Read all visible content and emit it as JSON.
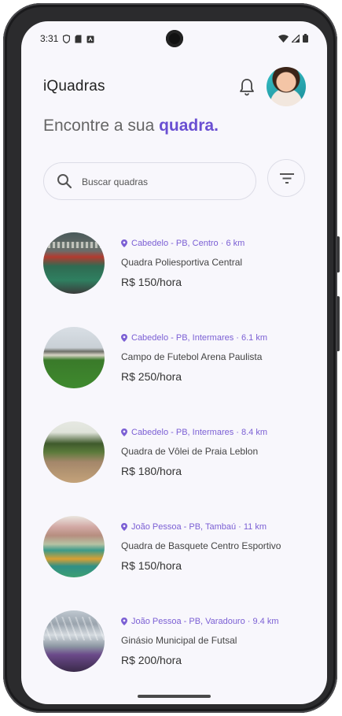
{
  "status": {
    "time": "3:31"
  },
  "header": {
    "title": "iQuadras"
  },
  "tagline": {
    "text": "Encontre a sua ",
    "highlight": "quadra."
  },
  "search": {
    "placeholder": "Buscar quadras",
    "value": ""
  },
  "colors": {
    "accent": "#6a4fd2",
    "location": "#7b5fd4",
    "background": "#f8f7fc"
  },
  "courts": [
    {
      "location": "Cabedelo - PB, Centro · 6 km",
      "name": "Quadra Poliesportiva Central",
      "price": "R$ 150/hora"
    },
    {
      "location": "Cabedelo - PB, Intermares · 6.1 km",
      "name": "Campo de Futebol Arena Paulista",
      "price": "R$ 250/hora"
    },
    {
      "location": "Cabedelo - PB, Intermares · 8.4 km",
      "name": "Quadra de Vôlei de Praia Leblon",
      "price": "R$ 180/hora"
    },
    {
      "location": "João Pessoa - PB, Tambaú · 11 km",
      "name": "Quadra de Basquete Centro Esportivo",
      "price": "R$ 150/hora"
    },
    {
      "location": "João Pessoa - PB, Varadouro · 9.4 km",
      "name": "Ginásio Municipal de Futsal",
      "price": "R$ 200/hora"
    }
  ]
}
